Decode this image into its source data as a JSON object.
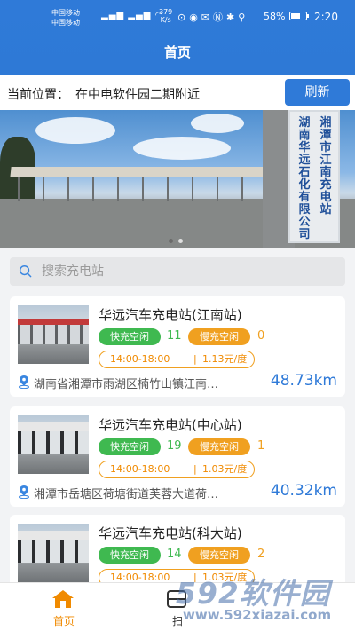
{
  "status_bar": {
    "carrier_1": "中国移动",
    "carrier_2": "中国移动",
    "net_speed_value": "379",
    "net_speed_unit": "K/s",
    "battery": "58%",
    "time": "2:20"
  },
  "header": {
    "title": "首页"
  },
  "location": {
    "label": "当前位置：",
    "value": "在中电软件园二期附近",
    "refresh_label": "刷新"
  },
  "banner": {
    "sign_line_1": "湘潭市江南充电站",
    "sign_line_2": "湖南华远石化有限公司",
    "slide_count": 2,
    "active_slide": 2,
    "active_dot_color": "#e0e0e0",
    "inactive_dot_color": "#6a6a6a"
  },
  "search": {
    "placeholder": "搜索充电站"
  },
  "stations": [
    {
      "name": "华远汽车充电站(江南站)",
      "fast_label": "快充空闲",
      "fast_count": "11",
      "slow_label": "慢充空闲",
      "slow_count": "0",
      "time_range": "14:00-18:00",
      "separator": "|",
      "price": "1.13元/度",
      "address": "湖南省湘潭市雨湖区楠竹山镇江南…",
      "distance": "48.73km"
    },
    {
      "name": "华远汽车充电站(中心站)",
      "fast_label": "快充空闲",
      "fast_count": "19",
      "slow_label": "慢充空闲",
      "slow_count": "1",
      "time_range": "14:00-18:00",
      "separator": "|",
      "price": "1.03元/度",
      "address": "湘潭市岳塘区荷塘街道芙蓉大道荷…",
      "distance": "40.32km"
    },
    {
      "name": "华远汽车充电站(科大站)",
      "fast_label": "快充空闲",
      "fast_count": "14",
      "slow_label": "慢充空闲",
      "slow_count": "2",
      "time_range": "14:00-18:00",
      "separator": "|",
      "price": "1.03元/度",
      "address": "",
      "distance": ""
    }
  ],
  "tabbar": {
    "home": "首页",
    "scan": "扫",
    "active_color": "#f08a00"
  },
  "watermark": {
    "brand": "592软件园",
    "url": "www.592xiazai.com"
  },
  "colors": {
    "primary": "#2f7ad8",
    "fast": "#3fb950",
    "slow": "#f0a020"
  }
}
